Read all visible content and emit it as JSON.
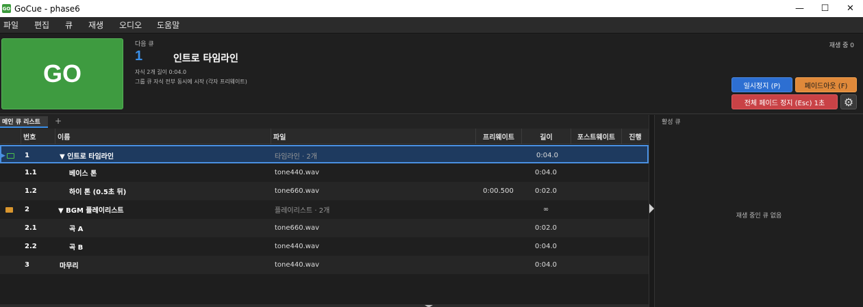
{
  "window": {
    "app_icon_text": "GO",
    "title": "GoCue - phase6",
    "minimize": "—",
    "maximize": "☐",
    "close": "✕"
  },
  "menu": [
    "파일",
    "편집",
    "큐",
    "재생",
    "오디오",
    "도움말"
  ],
  "go_button": "GO",
  "next_cue": {
    "label": "다음 큐",
    "number": "1",
    "name": "인트로 타임라인",
    "meta1": "자식 2개    길이 0:04.0",
    "meta2": "그룹 큐    자식 전부 동시에 시작 (각자 프리웨이트)"
  },
  "playing_count": "재생 중 0",
  "buttons": {
    "pause": "일시정지 (P)",
    "fadeout": "페이드아웃 (F)",
    "stop_all": "전체 페이드 정지 (Esc) 1초",
    "settings_icon": "⚙"
  },
  "tabs": {
    "main": "메인 큐 리스트",
    "add": "+"
  },
  "table": {
    "headers": {
      "number": "번호",
      "name": "이름",
      "file": "파일",
      "prewait": "프리웨이트",
      "length": "길이",
      "postwait": "포스트웨이트",
      "progress": "진행"
    },
    "rows": [
      {
        "icon": "folder-open",
        "number": "1",
        "name": "▼  인트로 타임라인",
        "file": "타임라인 · 2개",
        "prewait": "",
        "length": "0:04.0"
      },
      {
        "icon": "",
        "number": "1.1",
        "name": "베이스 톤",
        "file": "tone440.wav",
        "prewait": "",
        "length": "0:04.0"
      },
      {
        "icon": "",
        "number": "1.2",
        "name": "하이 톤 (0.5초 뒤)",
        "file": "tone660.wav",
        "prewait": "0:00.500",
        "length": "0:02.0"
      },
      {
        "icon": "folder",
        "number": "2",
        "name": "▼  BGM 플레이리스트",
        "file": "플레이리스트 · 2개",
        "prewait": "",
        "length": "∞"
      },
      {
        "icon": "",
        "number": "2.1",
        "name": "곡 A",
        "file": "tone660.wav",
        "prewait": "",
        "length": "0:02.0"
      },
      {
        "icon": "",
        "number": "2.2",
        "name": "곡 B",
        "file": "tone440.wav",
        "prewait": "",
        "length": "0:04.0"
      },
      {
        "icon": "",
        "number": "3",
        "name": "마무리",
        "file": "tone440.wav",
        "prewait": "",
        "length": "0:04.0"
      }
    ]
  },
  "active_panel": {
    "title": "활성 큐",
    "empty": "재생 중인 큐 없음"
  },
  "colors": {
    "go": "#3e9b40",
    "accent": "#3a8fe8",
    "pause": "#2d6fd2",
    "fade": "#e0893a",
    "stop": "#c94246"
  }
}
